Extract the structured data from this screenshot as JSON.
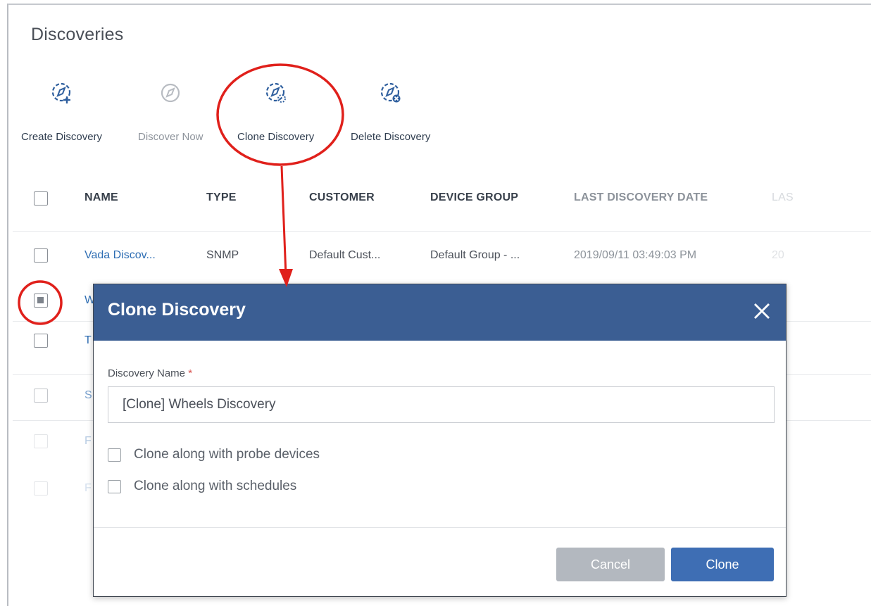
{
  "page": {
    "title": "Discoveries"
  },
  "toolbar": {
    "create": "Create Discovery",
    "discover_now": "Discover Now",
    "clone": "Clone Discovery",
    "delete": "Delete Discovery"
  },
  "table": {
    "columns": [
      "NAME",
      "TYPE",
      "CUSTOMER",
      "DEVICE GROUP",
      "LAST DISCOVERY DATE",
      "LAS"
    ],
    "rows": [
      {
        "name": "Vada Discov...",
        "type": "SNMP",
        "customer": "Default Cust...",
        "group": "Default Group - ...",
        "date": "2019/09/11 03:49:03 PM",
        "extra": "20"
      },
      {
        "name": "W"
      },
      {
        "name": "T"
      },
      {
        "name": "S"
      },
      {
        "name": "F"
      },
      {
        "name": "F"
      }
    ]
  },
  "dialog": {
    "title": "Clone Discovery",
    "field_label": "Discovery Name",
    "required_mark": "*",
    "name_value": "[Clone] Wheels Discovery",
    "option_probe": "Clone along with probe devices",
    "option_schedules": "Clone along with schedules",
    "cancel": "Cancel",
    "clone": "Clone"
  },
  "colors": {
    "dialog_header": "#3b5e93",
    "primary_button": "#3e6eb4",
    "link": "#2d6db3",
    "annotation_red": "#e0201b"
  },
  "icons": [
    "compass-add-icon",
    "compass-icon",
    "compass-clone-icon",
    "compass-delete-icon",
    "close-icon"
  ]
}
